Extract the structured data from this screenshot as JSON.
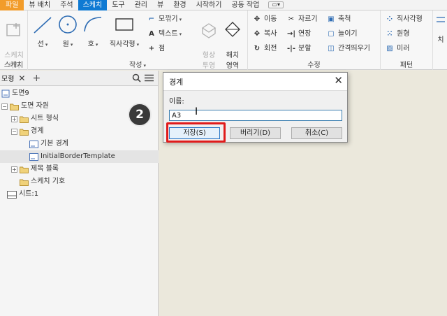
{
  "tabs": [
    "파일",
    "뷰 배치",
    "주석",
    "스케치",
    "도구",
    "관리",
    "뷰",
    "환경",
    "시작하기",
    "공동 작업"
  ],
  "active_tab": "스케치",
  "ribbon": {
    "sketch_group": {
      "label": "스케치",
      "start_label": "스케치\n시작"
    },
    "create_group": {
      "label": "작성",
      "line": "선",
      "circle": "원",
      "arc": "호",
      "rectangle": "직사각형",
      "fillet": "모깎기",
      "text": "텍스트",
      "point": "점",
      "project": "형상\n투영",
      "hatch": "해치\n영역"
    },
    "modify_group": {
      "label": "수정",
      "move": "이동",
      "copy": "복사",
      "rotate": "회전",
      "trim": "자르기",
      "extend": "연장",
      "split": "분할",
      "scale": "축척",
      "stretch": "늘이기",
      "offset": "간격띄우기"
    },
    "pattern_group": {
      "label": "패턴",
      "rect": "직사각형",
      "circular": "원형",
      "mirror": "미러"
    },
    "overflow_label": "치"
  },
  "panel": {
    "tab_label": "모형",
    "tree": [
      {
        "label": "도면9",
        "icon": "drawing-icon"
      },
      {
        "label": "도면 자원",
        "icon": "folder-icon"
      },
      {
        "label": "시트 형식",
        "icon": "folder-icon"
      },
      {
        "label": "경계",
        "icon": "folder-icon"
      },
      {
        "label": "기본 경계",
        "icon": "border-icon"
      },
      {
        "label": "InitialBorderTemplate",
        "icon": "border-icon"
      },
      {
        "label": "제목 블록",
        "icon": "folder-icon"
      },
      {
        "label": "스케치 기호",
        "icon": "symbol-icon"
      },
      {
        "label": "시트:1",
        "icon": "sheet-icon"
      }
    ]
  },
  "step_badge": "2",
  "dialog": {
    "title": "경계",
    "name_label": "이름:",
    "name_value": "A3",
    "save": "저장(S)",
    "discard": "버리기(D)",
    "cancel": "취소(C)"
  },
  "colors": {
    "accent": "#0f7ad3",
    "file_tab": "#f29c2a",
    "highlight": "#e01b1b"
  }
}
